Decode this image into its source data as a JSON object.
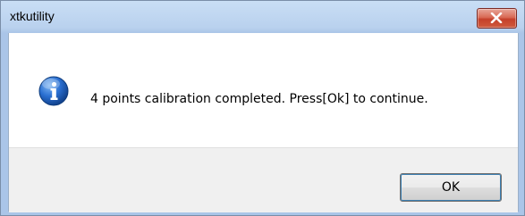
{
  "window": {
    "title": "xtkutility"
  },
  "dialog": {
    "message": "4 points calibration completed. Press[Ok] to continue.",
    "icon": "info-icon"
  },
  "buttons": {
    "ok_label": "OK",
    "close_icon": "close-icon"
  },
  "colors": {
    "close_button": "#c5402a",
    "info_icon": "#1f5fbf",
    "button_focus_border": "#3c7fb1"
  }
}
